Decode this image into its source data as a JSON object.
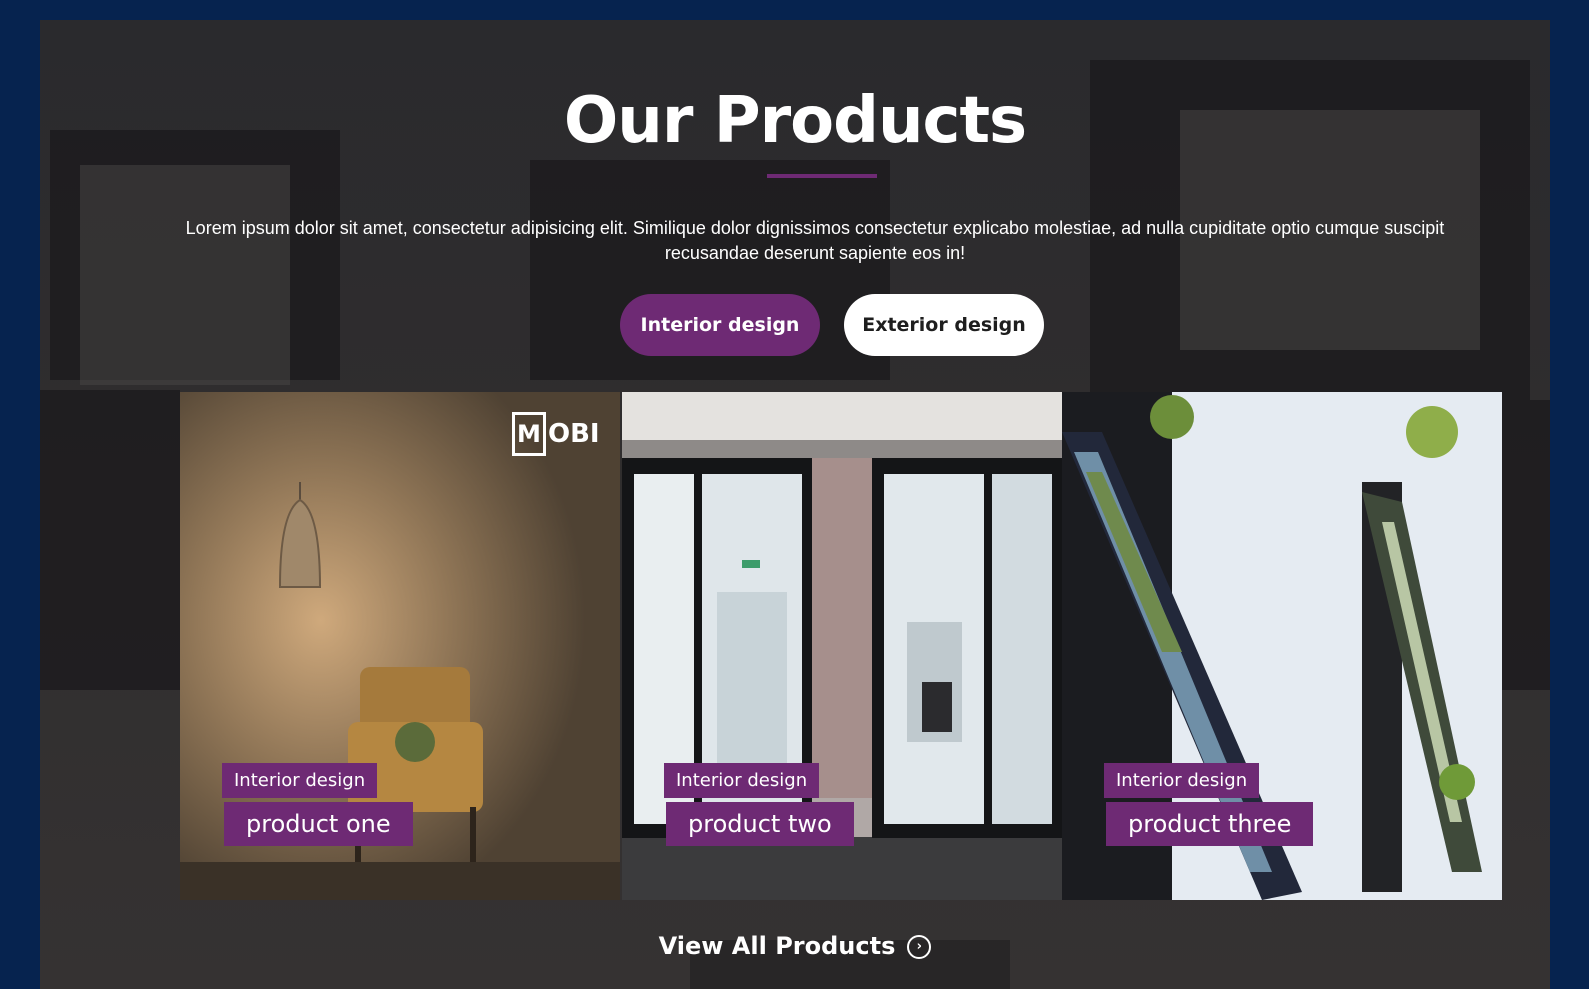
{
  "section": {
    "title": "Our Products",
    "description": "Lorem ipsum dolor sit amet, consectetur adipisicing elit. Similique dolor dignissimos consectetur explicabo molestiae, ad nulla cupiditate optio cumque suscipit recusandae deserunt sapiente eos in!"
  },
  "tabs": [
    {
      "label": "Interior design",
      "active": true
    },
    {
      "label": "Exterior design",
      "active": false
    }
  ],
  "products": [
    {
      "category": "Interior design",
      "name": "product one",
      "logo_text": "OBI",
      "logo_letter": "M"
    },
    {
      "category": "Interior design",
      "name": "product two"
    },
    {
      "category": "Interior design",
      "name": "product three"
    }
  ],
  "view_all": {
    "label": "View All Products",
    "icon": "arrow-right-circle-icon"
  },
  "colors": {
    "accent": "#6e2a74",
    "page_background": "#06234f",
    "text": "#ffffff"
  }
}
